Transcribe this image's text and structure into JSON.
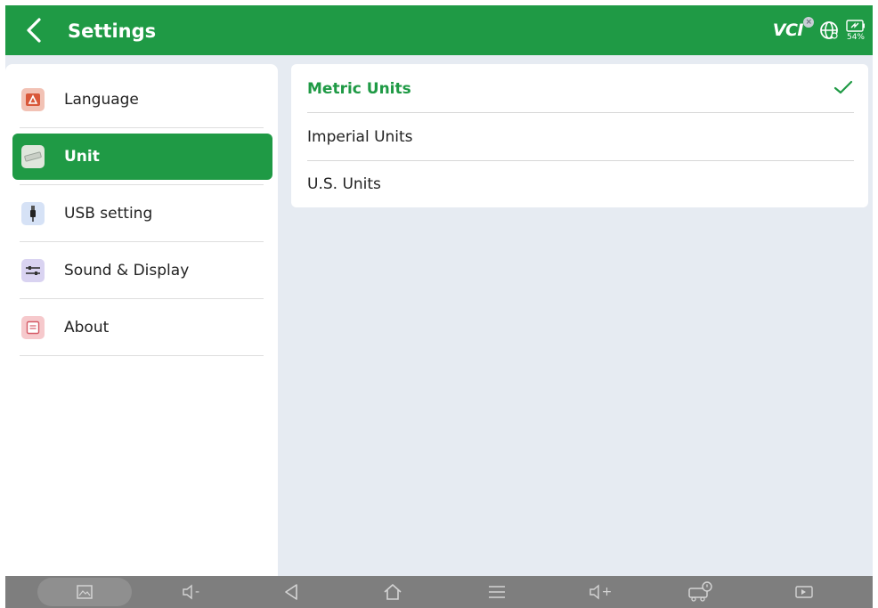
{
  "header": {
    "title": "Settings",
    "back_icon": "chevron-left-icon",
    "status": {
      "vci_label": "VCI",
      "vci_badge_icon": "disconnected-icon",
      "network_icon": "globe-icon",
      "battery_icon": "battery-charging-icon",
      "battery_level": "54%"
    }
  },
  "sidebar": {
    "items": [
      {
        "label": "Language",
        "icon": "language-icon",
        "active": false
      },
      {
        "label": "Unit",
        "icon": "ruler-icon",
        "active": true
      },
      {
        "label": "USB setting",
        "icon": "usb-icon",
        "active": false
      },
      {
        "label": "Sound & Display",
        "icon": "sliders-icon",
        "active": false
      },
      {
        "label": "About",
        "icon": "about-icon",
        "active": false
      }
    ]
  },
  "unit_options": {
    "selected": "Metric Units",
    "items": [
      {
        "label": "Metric Units",
        "selected": true
      },
      {
        "label": "Imperial Units",
        "selected": false
      },
      {
        "label": "U.S. Units",
        "selected": false
      }
    ]
  },
  "navbar": {
    "buttons": [
      {
        "icon": "screenshot-icon"
      },
      {
        "icon": "volume-down-icon",
        "text": "-"
      },
      {
        "icon": "back-icon"
      },
      {
        "icon": "home-icon"
      },
      {
        "icon": "menu-icon"
      },
      {
        "icon": "volume-up-icon",
        "text": "+"
      },
      {
        "icon": "vehicle-diagnostic-icon"
      },
      {
        "icon": "screen-record-icon"
      }
    ]
  },
  "colors": {
    "accent": "#1f9a45",
    "background": "#e6ebf2",
    "navbar": "#7e7e7e"
  }
}
